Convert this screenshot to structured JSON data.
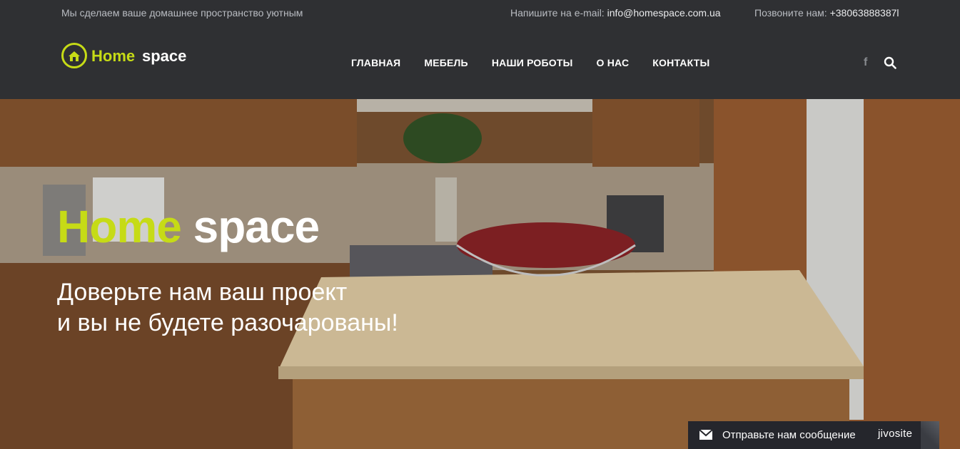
{
  "topbar": {
    "tagline": "Мы сделаем ваше домашнее пространство уютным",
    "email_label": "Напишите на e-mail: ",
    "email_value": "info@homespace.com.ua",
    "phone_label": "Позвоните нам: ",
    "phone_value": "+38063888387l"
  },
  "logo": {
    "word1": "Home",
    "word2": "space",
    "accent": "#c6db16"
  },
  "nav": {
    "items": [
      "ГЛАВНАЯ",
      "МЕБЕЛЬ",
      "НАШИ РОБОТЫ",
      "О НАС",
      "КОНТАКТЫ"
    ]
  },
  "social": {
    "facebook_glyph": "f",
    "search_icon": "search-icon"
  },
  "hero": {
    "title_word1": "Home",
    "title_word2": "space",
    "line1": "Доверьте нам ваш проект",
    "line2": "и вы не будете разочарованы!"
  },
  "chat": {
    "message": "Отправьте нам сообщение",
    "brand": "jivosite"
  },
  "colors": {
    "header_bg": "#2f3033",
    "accent": "#c6db16"
  }
}
